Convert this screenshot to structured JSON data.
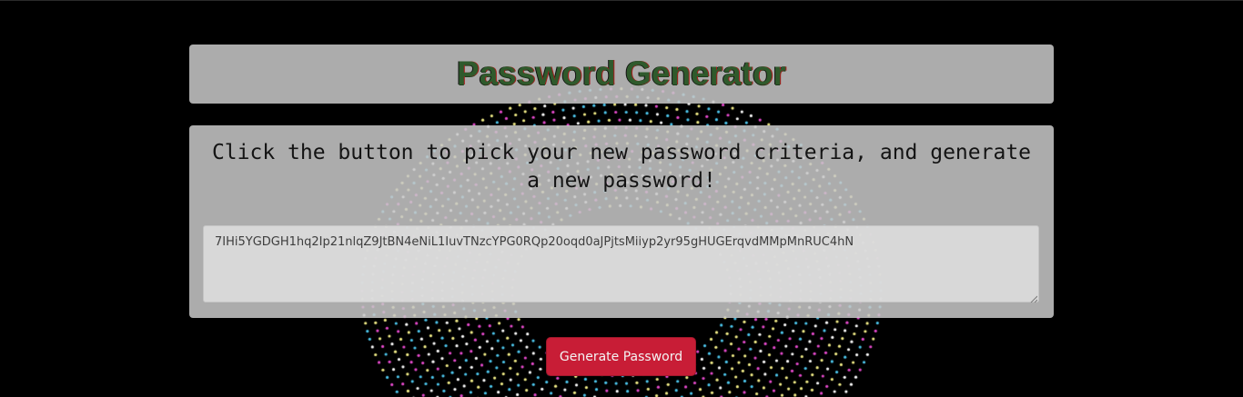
{
  "header": {
    "title": "Password Generator"
  },
  "main": {
    "prompt": "Click the button to pick your new password criteria, and generate a new password!",
    "password_value": "7IHi5YGDGH1hq2Ip21nlqZ9JtBN4eNiL1IuvTNzcYPG0RQp20oqd0aJPjtsMiiyp2yr95gHUGErqvdMMpMnRUC4hN",
    "generate_label": "Generate Password"
  },
  "colors": {
    "background": "#000000",
    "card": "#c8c8c8",
    "button": "#c81d36",
    "dot_palette": [
      "#f5f08a",
      "#4ec9f0",
      "#e94bd0",
      "#ffffff"
    ]
  }
}
